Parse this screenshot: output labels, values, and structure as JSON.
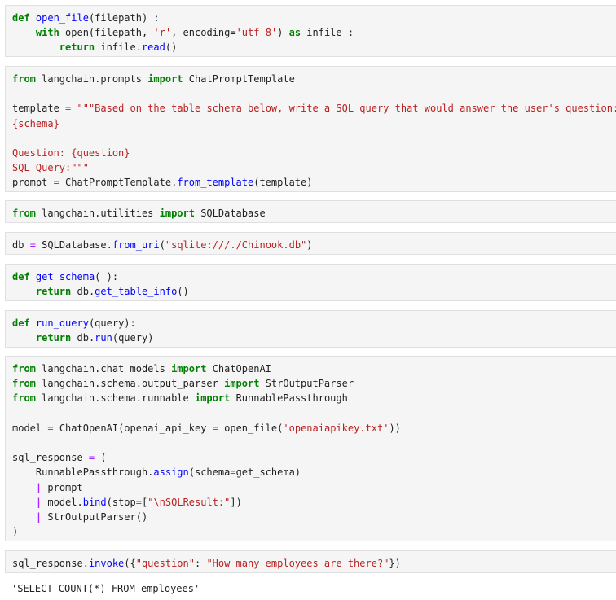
{
  "cells": [
    {
      "id": "cell-open-file",
      "lines": [
        [
          [
            "kw",
            "def"
          ],
          [
            "nm",
            " "
          ],
          [
            "fn",
            "open_file"
          ],
          [
            "nm",
            "(filepath) :"
          ]
        ],
        [
          [
            "nm",
            "    "
          ],
          [
            "kw",
            "with"
          ],
          [
            "nm",
            " open(filepath, "
          ],
          [
            "st",
            "'r'"
          ],
          [
            "nm",
            ", encoding="
          ],
          [
            "st",
            "'utf-8'"
          ],
          [
            "nm",
            ") "
          ],
          [
            "kw",
            "as"
          ],
          [
            "nm",
            " infile :"
          ]
        ],
        [
          [
            "nm",
            "        "
          ],
          [
            "kw",
            "return"
          ],
          [
            "nm",
            " infile."
          ],
          [
            "fn",
            "read"
          ],
          [
            "nm",
            "()"
          ]
        ]
      ]
    },
    {
      "id": "cell-prompt-template",
      "lines": [
        [
          [
            "kw",
            "from"
          ],
          [
            "nm",
            " langchain.prompts "
          ],
          [
            "kw",
            "import"
          ],
          [
            "nm",
            " ChatPromptTemplate"
          ]
        ],
        [],
        [
          [
            "nm",
            "template "
          ],
          [
            "op",
            "="
          ],
          [
            "nm",
            " "
          ],
          [
            "st",
            "\"\"\"Based on the table schema below, write a SQL query that would answer the user's question:"
          ]
        ],
        [
          [
            "st",
            "{schema}"
          ]
        ],
        [],
        [
          [
            "st",
            "Question: {question}"
          ]
        ],
        [
          [
            "st",
            "SQL Query:\"\"\""
          ]
        ],
        [
          [
            "nm",
            "prompt "
          ],
          [
            "op",
            "="
          ],
          [
            "nm",
            " ChatPromptTemplate."
          ],
          [
            "fn",
            "from_template"
          ],
          [
            "nm",
            "(template)"
          ]
        ]
      ]
    },
    {
      "id": "cell-import-sqldatabase",
      "lines": [
        [
          [
            "kw",
            "from"
          ],
          [
            "nm",
            " langchain.utilities "
          ],
          [
            "kw",
            "import"
          ],
          [
            "nm",
            " SQLDatabase"
          ]
        ]
      ]
    },
    {
      "id": "cell-db",
      "lines": [
        [
          [
            "nm",
            "db "
          ],
          [
            "op",
            "="
          ],
          [
            "nm",
            " SQLDatabase."
          ],
          [
            "fn",
            "from_uri"
          ],
          [
            "nm",
            "("
          ],
          [
            "st",
            "\"sqlite:///./Chinook.db\""
          ],
          [
            "nm",
            ")"
          ]
        ]
      ]
    },
    {
      "id": "cell-get-schema",
      "lines": [
        [
          [
            "kw",
            "def"
          ],
          [
            "nm",
            " "
          ],
          [
            "fn",
            "get_schema"
          ],
          [
            "nm",
            "(_):"
          ]
        ],
        [
          [
            "nm",
            "    "
          ],
          [
            "kw",
            "return"
          ],
          [
            "nm",
            " db."
          ],
          [
            "fn",
            "get_table_info"
          ],
          [
            "nm",
            "()"
          ]
        ]
      ]
    },
    {
      "id": "cell-run-query",
      "lines": [
        [
          [
            "kw",
            "def"
          ],
          [
            "nm",
            " "
          ],
          [
            "fn",
            "run_query"
          ],
          [
            "nm",
            "(query):"
          ]
        ],
        [
          [
            "nm",
            "    "
          ],
          [
            "kw",
            "return"
          ],
          [
            "nm",
            " db."
          ],
          [
            "fn",
            "run"
          ],
          [
            "nm",
            "(query)"
          ]
        ]
      ]
    },
    {
      "id": "cell-sql-response",
      "lines": [
        [
          [
            "kw",
            "from"
          ],
          [
            "nm",
            " langchain.chat_models "
          ],
          [
            "kw",
            "import"
          ],
          [
            "nm",
            " ChatOpenAI"
          ]
        ],
        [
          [
            "kw",
            "from"
          ],
          [
            "nm",
            " langchain.schema.output_parser "
          ],
          [
            "kw",
            "import"
          ],
          [
            "nm",
            " StrOutputParser"
          ]
        ],
        [
          [
            "kw",
            "from"
          ],
          [
            "nm",
            " langchain.schema.runnable "
          ],
          [
            "kw",
            "import"
          ],
          [
            "nm",
            " RunnablePassthrough"
          ]
        ],
        [],
        [
          [
            "nm",
            "model "
          ],
          [
            "op",
            "="
          ],
          [
            "nm",
            " ChatOpenAI(openai_api_key "
          ],
          [
            "op",
            "="
          ],
          [
            "nm",
            " open_file("
          ],
          [
            "st",
            "'openaiapikey.txt'"
          ],
          [
            "nm",
            "))"
          ]
        ],
        [],
        [
          [
            "nm",
            "sql_response "
          ],
          [
            "op",
            "="
          ],
          [
            "nm",
            " ("
          ]
        ],
        [
          [
            "nm",
            "    RunnablePassthrough."
          ],
          [
            "fn",
            "assign"
          ],
          [
            "nm",
            "(schema"
          ],
          [
            "op",
            "="
          ],
          [
            "nm",
            "get_schema)"
          ]
        ],
        [
          [
            "nm",
            "    "
          ],
          [
            "pipe",
            "|"
          ],
          [
            "nm",
            " prompt"
          ]
        ],
        [
          [
            "nm",
            "    "
          ],
          [
            "pipe",
            "|"
          ],
          [
            "nm",
            " model."
          ],
          [
            "fn",
            "bind"
          ],
          [
            "nm",
            "(stop"
          ],
          [
            "op",
            "="
          ],
          [
            "nm",
            "["
          ],
          [
            "st",
            "\"\\nSQLResult:\""
          ],
          [
            "nm",
            "])"
          ]
        ],
        [
          [
            "nm",
            "    "
          ],
          [
            "pipe",
            "|"
          ],
          [
            "nm",
            " StrOutputParser()"
          ]
        ],
        [
          [
            "nm",
            ")"
          ]
        ]
      ]
    },
    {
      "id": "cell-invoke",
      "lines": [
        [
          [
            "nm",
            "sql_response."
          ],
          [
            "fn",
            "invoke"
          ],
          [
            "nm",
            "({"
          ],
          [
            "st",
            "\"question\""
          ],
          [
            "nm",
            ": "
          ],
          [
            "st",
            "\"How many employees are there?\""
          ],
          [
            "nm",
            "})"
          ]
        ]
      ]
    }
  ],
  "output": {
    "text": "'SELECT COUNT(*) FROM employees'"
  }
}
